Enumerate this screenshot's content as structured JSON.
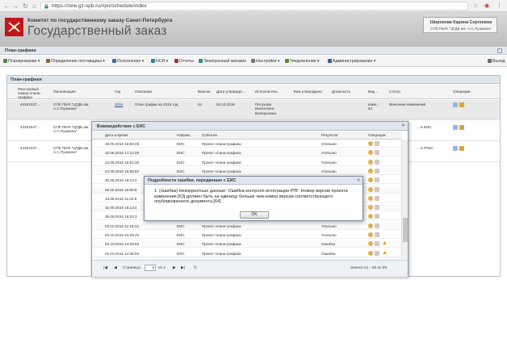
{
  "browser": {
    "url": "https://new.gz-spb.ru/#po/schedule/index"
  },
  "header": {
    "org": "Комитет по государственному заказу Санкт-Петербурга",
    "title": "Государственный заказ",
    "user_name": "Шиpокова Карина Сергеевна",
    "user_org": "СПб ГБУК \"ЦГДБ им. А.С.Пушкина\""
  },
  "panel_title": "План-графики",
  "menu": {
    "items": [
      "Планирование ▾",
      "Определение поставщика ▾",
      "Исполнение ▾",
      "НСИ ▾",
      "Отчеты",
      "Электронный магазин",
      "Настройки ▾",
      "Уведомления ▾",
      "Администрирование ▾"
    ],
    "exit": "Выход"
  },
  "main": {
    "title": "План-графики",
    "columns": [
      "Реестровый номер плана-графика",
      "Организация",
      "Год",
      "Описание",
      "Версия",
      "Дата утвержде...",
      "Исполнитель",
      "Кем утверждено",
      "Должность",
      "Вид ...",
      "Статус",
      "Операции"
    ],
    "rows": [
      {
        "reg": "44201037...",
        "org": "СПб ГБУК \"ЦГДБ им. А.С.Пушкина\"",
        "year": "2016",
        "desc": "План график на 2016 год",
        "version": "64",
        "date": "04.10.2016",
        "executor": "Петухова Валентина Валерьевна",
        "kind": "изме... 64",
        "status": "Внесение изменений"
      },
      {
        "reg": "44201537...",
        "org": "СПб ГБУК \"ЦГДБ им. А.С.Пушкина\"",
        "status": "... в ЕИС"
      },
      {
        "reg": "44201037...",
        "org": "СПб ГБУК \"ЦГДБ им. А.С.Пушкина\"",
        "status": "... в ГРБС"
      }
    ]
  },
  "dialog": {
    "title": "Взаимодействие с ЕИС",
    "columns": [
      "Дата и время",
      "Направ...",
      "Событие",
      "Результат",
      "Операции"
    ],
    "rows": [
      {
        "dt": "19.08.2016 15:50:25",
        "dir": "ЕИС",
        "event": "Проект плана-графика",
        "result": "Успешно"
      },
      {
        "dt": "22.08.2016 17:12:29",
        "dir": "ЕИС",
        "event": "Проект плана-графика",
        "result": "Успешно"
      },
      {
        "dt": "23.08.2016 16:51:30",
        "dir": "ЕИС",
        "event": "Проект плана-графика",
        "result": "Успешно"
      },
      {
        "dt": "24.08.2016 16:56:52",
        "dir": "ЕИС",
        "event": "Проект плана-графика",
        "result": "Успешно"
      },
      {
        "dt": "30.08.2016 16:14:2",
        "dir": "ЕИС",
        "event": "Проект плана-графика",
        "result": "Успешно"
      },
      {
        "dt": "06.09.2016 15:05:5",
        "dir": "ЕИС",
        "event": "Проект плана-графика",
        "result": "Успешно"
      },
      {
        "dt": "13.09.2016 11:42:5",
        "dir": "ЕИС",
        "event": "Проект плана-графика",
        "result": "Успешно"
      },
      {
        "dt": "15.09.2016 15:13:4",
        "dir": "ЕИС",
        "event": "Проект плана-графика",
        "result": "Успешно"
      },
      {
        "dt": "29.09.2016 16:24:3",
        "dir": "ЕИС",
        "event": "Проект плана-графика",
        "result": "Успешно"
      },
      {
        "dt": "03.10.2016 11:15:14",
        "dir": "ЕИС",
        "event": "Проект плана-графика",
        "result": "Успешно"
      },
      {
        "dt": "04.10.2016 10:26:20",
        "dir": "ЕИС",
        "event": "Проект плана-графика",
        "result": "Успешно"
      },
      {
        "dt": "04.10.2016 14:25:53",
        "dir": "ЕИС",
        "event": "Проект плана-графика",
        "result": "Ошибка"
      },
      {
        "dt": "04.10.2016 14:36:04",
        "dir": "ЕИС",
        "event": "Проект плана-графика",
        "result": "Ошибка"
      }
    ],
    "pager": {
      "page_label": "Страница",
      "page": "2",
      "of": "из 2",
      "records": "Записи 51 - 60 из 59"
    }
  },
  "error_dialog": {
    "title": "Подробности ошибки, переданные с ЕИС",
    "message": "1. (ошибка) Некорректные данные: Ошибка контроля интеграции РПГ. Номер версии проекта изменения [63] должен быть на единицу больше чем номер версии соответствующего опубликованного документа [64]",
    "ok": "OK"
  },
  "colors": {
    "accent": "#c3161c",
    "link": "#1f4e9a"
  }
}
